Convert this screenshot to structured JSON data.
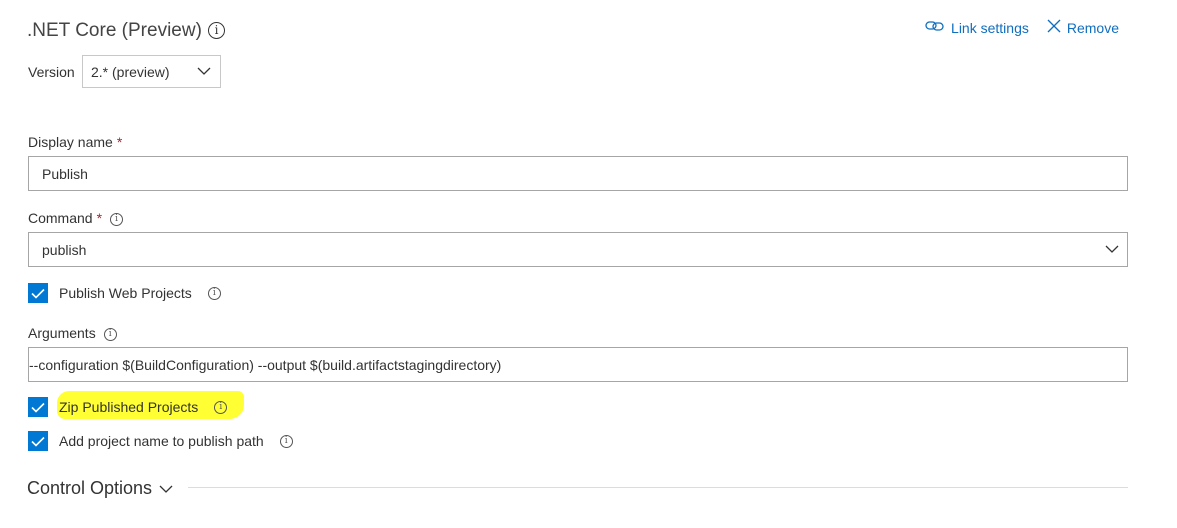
{
  "task": {
    "title": ".NET Core (Preview)",
    "title_info_icon": "info-icon",
    "link_settings_label": "Link settings",
    "remove_label": "Remove"
  },
  "version": {
    "label": "Version",
    "selected": "2.* (preview)"
  },
  "display_name": {
    "label": "Display name",
    "required_mark": "*",
    "value": "Publish"
  },
  "command": {
    "label": "Command",
    "required_mark": "*",
    "selected": "publish"
  },
  "publish_web_projects": {
    "label": "Publish Web Projects",
    "checked": true
  },
  "arguments": {
    "label": "Arguments",
    "value": "--configuration $(BuildConfiguration) --output $(build.artifactstagingdirectory)"
  },
  "zip_published_projects": {
    "label": "Zip Published Projects",
    "checked": true,
    "highlight_color": "#ffff33"
  },
  "add_project_name": {
    "label": "Add project name to publish path",
    "checked": true
  },
  "control_options": {
    "label": "Control Options"
  },
  "colors": {
    "accent": "#0078d4",
    "link": "#106ebe"
  }
}
